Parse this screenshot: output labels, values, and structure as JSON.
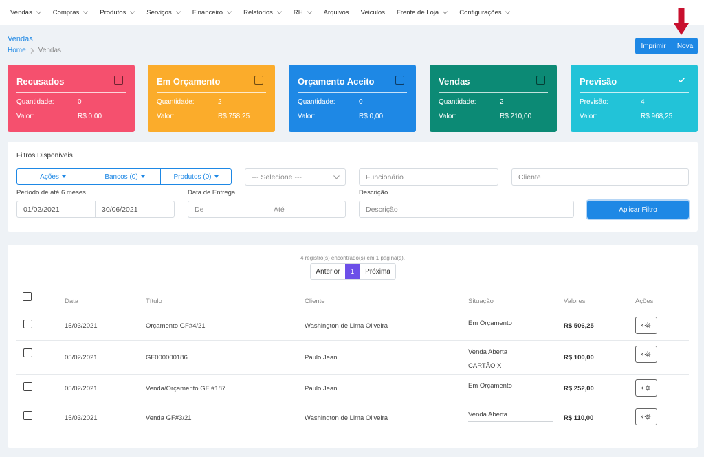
{
  "nav": [
    {
      "label": "Vendas",
      "dropdown": true
    },
    {
      "label": "Compras",
      "dropdown": true
    },
    {
      "label": "Produtos",
      "dropdown": true
    },
    {
      "label": "Serviços",
      "dropdown": true
    },
    {
      "label": "Financeiro",
      "dropdown": true
    },
    {
      "label": "Relatorios",
      "dropdown": true
    },
    {
      "label": "RH",
      "dropdown": true
    },
    {
      "label": "Arquivos",
      "dropdown": false
    },
    {
      "label": "Veiculos",
      "dropdown": false
    },
    {
      "label": "Frente de Loja",
      "dropdown": true
    },
    {
      "label": "Configurações",
      "dropdown": true
    }
  ],
  "header": {
    "title": "Vendas",
    "breadcrumb_home": "Home",
    "breadcrumb_current": "Vendas",
    "print_label": "Imprimir",
    "new_label": "Nova"
  },
  "cards": [
    {
      "title": "Recusados",
      "color": "#f5506e",
      "checked": false,
      "k1": "Quantidade:",
      "v1": "0",
      "k2": "Valor:",
      "v2": "R$ 0,00"
    },
    {
      "title": "Em Orçamento",
      "color": "#fbac2b",
      "checked": false,
      "k1": "Quantidade:",
      "v1": "2",
      "k2": "Valor:",
      "v2": "R$ 758,25"
    },
    {
      "title": "Orçamento Aceito",
      "color": "#1e88e5",
      "checked": false,
      "k1": "Quantidade:",
      "v1": "0",
      "k2": "Valor:",
      "v2": "R$ 0,00"
    },
    {
      "title": "Vendas",
      "color": "#0c8a75",
      "checked": false,
      "k1": "Quantidade:",
      "v1": "2",
      "k2": "Valor:",
      "v2": "R$ 210,00"
    },
    {
      "title": "Previsão",
      "color": "#22c3d8",
      "checked": true,
      "k1": "Previsão:",
      "v1": "4",
      "k2": "Valor:",
      "v2": "R$ 968,25"
    }
  ],
  "filters": {
    "title": "Filtros Disponíveis",
    "actions_label": "Ações",
    "banks_label": "Bancos (0)",
    "products_label": "Produtos (0)",
    "select_placeholder": "--- Selecione ---",
    "employee_placeholder": "Funcionário",
    "client_placeholder": "Cliente",
    "period_label": "Período de até 6 meses",
    "date_from": "01/02/2021",
    "date_to": "30/06/2021",
    "delivery_label": "Data de Entrega",
    "delivery_from_placeholder": "De",
    "delivery_to_placeholder": "Até",
    "description_label": "Descrição",
    "description_placeholder": "Descrição",
    "apply_label": "Aplicar Filtro"
  },
  "table": {
    "records_text": "4 registro(s) encontrado(s) em 1 página(s).",
    "prev_label": "Anterior",
    "current_page": "1",
    "next_label": "Próxima",
    "headers": {
      "date": "Data",
      "title": "Título",
      "client": "Cliente",
      "status": "Situação",
      "value": "Valores",
      "actions": "Ações"
    },
    "rows": [
      {
        "date": "15/03/2021",
        "title": "Orçamento GF#4/21",
        "client": "Washington de Lima Oliveira",
        "status": "Em Orçamento",
        "status_sub": "",
        "value": "R$ 506,25"
      },
      {
        "date": "05/02/2021",
        "title": "GF000000186",
        "client": "Paulo Jean",
        "status": "Venda Aberta",
        "status_sub": "CARTÃO X",
        "value": "R$ 100,00"
      },
      {
        "date": "05/02/2021",
        "title": "Venda/Orçamento GF #187",
        "client": "Paulo Jean",
        "status": "Em Orçamento",
        "status_sub": "",
        "value": "R$ 252,00"
      },
      {
        "date": "15/03/2021",
        "title": "Venda GF#3/21",
        "client": "Washington de Lima Oliveira",
        "status": "Venda Aberta",
        "status_sub": "",
        "value": "R$ 110,00"
      }
    ]
  }
}
